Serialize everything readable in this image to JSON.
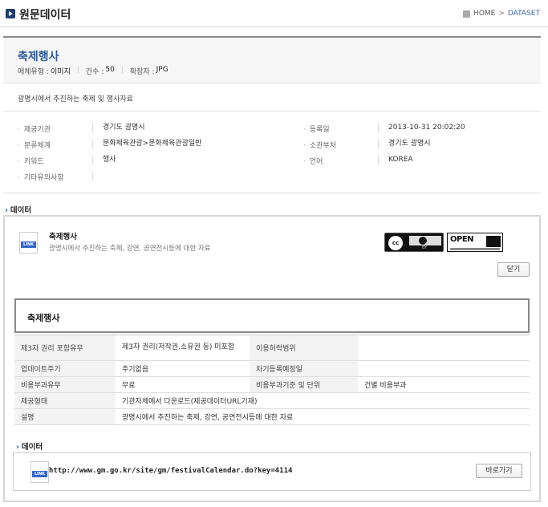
{
  "header": {
    "title": "원문데이터",
    "breadcrumb": [
      "HOME",
      "DATASET"
    ],
    "breadcrumb_sep": ">"
  },
  "dataset": {
    "title": "축제행사",
    "meta": [
      {
        "label": "매체유형 :",
        "value": "이미지"
      },
      {
        "label": "건수 :",
        "value": "50"
      },
      {
        "label": "확장자 :",
        "value": "JPG"
      }
    ],
    "description": "광명시에서 추진하는 축제 및 행사자료",
    "attributes_left": [
      {
        "label": "제공기관",
        "value": "경기도 광명시"
      },
      {
        "label": "분류체계",
        "value": "문화체육관광>문화체육관광일반"
      },
      {
        "label": "키워드",
        "value": "행사"
      },
      {
        "label": "기타유의사항",
        "value": ""
      }
    ],
    "attributes_right": [
      {
        "label": "등록일",
        "value": "2013-10-31 20:02:20"
      },
      {
        "label": "소관부처",
        "value": "경기도 광명시"
      },
      {
        "label": "언어",
        "value": "KOREA"
      }
    ]
  },
  "data_section": {
    "heading": "데이터",
    "item_title": "축제행사",
    "item_description": "광명시에서 추진하는 축제, 강연, 공연전시등에 대한 자료",
    "link_icon_label": "LINK",
    "cc_label": "cc",
    "by_label": "BY",
    "open_label": "OPEN",
    "close_button": "닫기",
    "table_title": "축제행사",
    "rows": [
      {
        "l1": "제3자 권리 포함유무",
        "v1": "제3자 권리(저작권,소유권 등) 미포함",
        "l2": "이용허락범위",
        "v2": ""
      },
      {
        "l1": "업데이트주기",
        "v1": "주기없음",
        "l2": "차기등록예정일",
        "v2": ""
      },
      {
        "l1": "비용부과유무",
        "v1": "무료",
        "l2": "비용부과기준 및 단위",
        "v2": "건별 비용부과"
      },
      {
        "l1": "제공형태",
        "v1": "기관자체에서 다운로드(제공데이터URL기재)"
      },
      {
        "l1": "설명",
        "v1": "광명시에서 추진하는 축제, 강연, 공연전시등에 대한 자료"
      }
    ],
    "sub_heading": "데이터",
    "url": "http://www.gm.go.kr/site/gm/festivalCalendar.do?key=4114",
    "go_button": "바로가기"
  },
  "colors": {
    "accent": "#2a5a9a",
    "badge_dark": "#111111",
    "link_blue": "#3366cc"
  }
}
